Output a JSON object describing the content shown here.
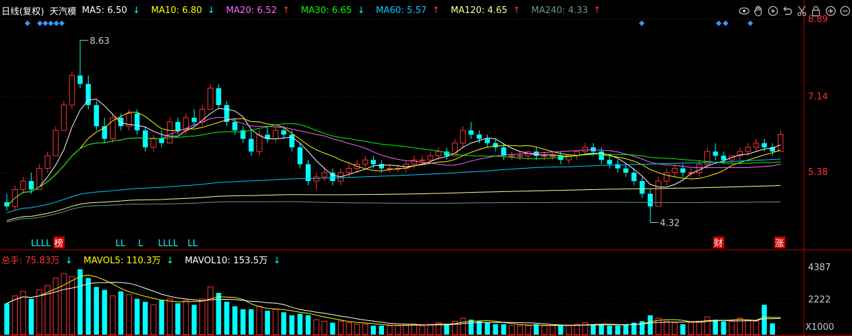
{
  "legend": {
    "period": "日线(复权)",
    "stock": "天汽模",
    "ma": [
      {
        "label": "MA5: 6.50",
        "arrow": "↓",
        "color": "#ffffff"
      },
      {
        "label": "MA10: 6.80",
        "arrow": "↓",
        "color": "#ffff00"
      },
      {
        "label": "MA20: 6.52",
        "arrow": "↑",
        "color": "#ff66ff"
      },
      {
        "label": "MA30: 6.65",
        "arrow": "↓",
        "color": "#00ff00"
      },
      {
        "label": "MA60: 5.57",
        "arrow": "↑",
        "color": "#00ccff"
      },
      {
        "label": "MA120: 4.65",
        "arrow": "↑",
        "color": "#ffff99"
      },
      {
        "label": "MA240: 4.33",
        "arrow": "↑",
        "color": "#669999"
      }
    ]
  },
  "vol_legend": {
    "total": "总手: 75.83万",
    "total_arrow": "↓",
    "mavol5": "MAVOL5: 110.3万",
    "mavol5_arrow": "↓",
    "mavol10": "MAVOL10: 153.5万",
    "mavol10_arrow": "↓"
  },
  "toolbar": [
    "eye-icon",
    "hand-icon",
    "play-icon",
    "undo-icon",
    "scissors-icon",
    "lock-icon",
    "zoom-in-icon",
    "zoom-out-icon"
  ],
  "price_axis": {
    "ticks": [
      "8.89",
      "7.14",
      "5.38"
    ],
    "color": "#ff3333"
  },
  "volume_axis": {
    "ticks": [
      "4387",
      "2222"
    ],
    "unit": "X1000"
  },
  "annotations": {
    "high": "8.63",
    "low": "4.32"
  },
  "event_markers": [
    {
      "text": "LLLL",
      "color": "#00ffff"
    },
    {
      "text": "榜",
      "color": "#ffffff",
      "bg": "#cc0000"
    },
    {
      "text": "LL",
      "color": "#00ffff"
    },
    {
      "text": "L",
      "color": "#00ffff"
    },
    {
      "text": "LLLL",
      "color": "#00ffff"
    },
    {
      "text": "LL",
      "color": "#00ffff"
    },
    {
      "text": "财",
      "color": "#ffffff",
      "bg": "#cc0000"
    },
    {
      "text": "涨",
      "color": "#ffffff",
      "bg": "#cc0000"
    }
  ],
  "colors": {
    "up": "#ff3333",
    "down": "#00ffff",
    "grid": "#cc0000",
    "bg": "#000000",
    "diamond": "#3399ff"
  },
  "chart_data": {
    "type": "candlestick",
    "price_range": [
      4.1,
      9.1
    ],
    "ohlc": [
      [
        4.8,
        5.0,
        4.6,
        4.7
      ],
      [
        4.7,
        5.2,
        4.6,
        5.1
      ],
      [
        5.1,
        5.4,
        5.0,
        5.3
      ],
      [
        5.3,
        5.5,
        5.0,
        5.1
      ],
      [
        5.1,
        5.7,
        5.1,
        5.6
      ],
      [
        5.6,
        6.0,
        5.5,
        5.9
      ],
      [
        5.9,
        6.6,
        5.9,
        6.5
      ],
      [
        6.5,
        7.2,
        6.5,
        7.1
      ],
      [
        7.1,
        7.9,
        7.0,
        7.8
      ],
      [
        7.8,
        8.63,
        7.5,
        7.6
      ],
      [
        7.6,
        7.8,
        7.0,
        7.1
      ],
      [
        7.1,
        7.2,
        6.5,
        6.6
      ],
      [
        6.6,
        6.8,
        6.2,
        6.3
      ],
      [
        6.3,
        6.9,
        6.2,
        6.8
      ],
      [
        6.8,
        6.9,
        6.5,
        6.6
      ],
      [
        6.6,
        7.0,
        6.5,
        6.9
      ],
      [
        6.9,
        7.0,
        6.4,
        6.5
      ],
      [
        6.5,
        6.6,
        6.0,
        6.1
      ],
      [
        6.1,
        6.4,
        6.0,
        6.3
      ],
      [
        6.3,
        6.5,
        6.1,
        6.2
      ],
      [
        6.2,
        6.8,
        6.2,
        6.7
      ],
      [
        6.7,
        6.8,
        6.4,
        6.5
      ],
      [
        6.5,
        6.9,
        6.4,
        6.8
      ],
      [
        6.8,
        7.0,
        6.6,
        6.7
      ],
      [
        6.7,
        7.1,
        6.6,
        7.0
      ],
      [
        7.0,
        7.6,
        7.0,
        7.5
      ],
      [
        7.5,
        7.6,
        7.0,
        7.1
      ],
      [
        7.1,
        7.2,
        6.6,
        6.7
      ],
      [
        6.7,
        6.8,
        6.4,
        6.5
      ],
      [
        6.5,
        6.6,
        6.2,
        6.3
      ],
      [
        6.3,
        6.5,
        5.9,
        6.0
      ],
      [
        6.0,
        6.5,
        5.9,
        6.4
      ],
      [
        6.4,
        6.6,
        6.2,
        6.3
      ],
      [
        6.3,
        6.6,
        6.2,
        6.5
      ],
      [
        6.5,
        6.6,
        6.3,
        6.4
      ],
      [
        6.4,
        6.5,
        6.0,
        6.1
      ],
      [
        6.1,
        6.2,
        5.6,
        5.7
      ],
      [
        5.7,
        5.8,
        5.2,
        5.3
      ],
      [
        5.3,
        5.5,
        5.1,
        5.4
      ],
      [
        5.4,
        5.6,
        5.3,
        5.5
      ],
      [
        5.5,
        5.6,
        5.2,
        5.3
      ],
      [
        5.3,
        5.6,
        5.2,
        5.5
      ],
      [
        5.5,
        5.7,
        5.4,
        5.6
      ],
      [
        5.6,
        5.8,
        5.5,
        5.7
      ],
      [
        5.7,
        5.9,
        5.6,
        5.8
      ],
      [
        5.8,
        5.9,
        5.6,
        5.7
      ],
      [
        5.7,
        5.8,
        5.5,
        5.6
      ],
      [
        5.6,
        5.7,
        5.5,
        5.6
      ],
      [
        5.6,
        5.7,
        5.5,
        5.6
      ],
      [
        5.6,
        5.8,
        5.5,
        5.7
      ],
      [
        5.7,
        5.9,
        5.6,
        5.8
      ],
      [
        5.8,
        5.9,
        5.7,
        5.8
      ],
      [
        5.8,
        6.0,
        5.7,
        5.9
      ],
      [
        5.9,
        6.1,
        5.8,
        6.0
      ],
      [
        6.0,
        6.1,
        5.8,
        5.9
      ],
      [
        5.9,
        6.3,
        5.9,
        6.2
      ],
      [
        6.2,
        6.6,
        6.1,
        6.5
      ],
      [
        6.5,
        6.7,
        6.3,
        6.4
      ],
      [
        6.4,
        6.5,
        6.2,
        6.3
      ],
      [
        6.3,
        6.4,
        6.1,
        6.2
      ],
      [
        6.2,
        6.3,
        6.0,
        6.1
      ],
      [
        6.1,
        6.2,
        5.8,
        5.9
      ],
      [
        5.9,
        6.0,
        5.8,
        5.9
      ],
      [
        5.9,
        6.0,
        5.8,
        5.9
      ],
      [
        5.9,
        6.0,
        5.8,
        6.0
      ],
      [
        6.0,
        6.1,
        5.8,
        5.9
      ],
      [
        5.9,
        6.0,
        5.8,
        5.9
      ],
      [
        5.9,
        6.0,
        5.8,
        5.9
      ],
      [
        5.9,
        6.0,
        5.7,
        5.8
      ],
      [
        5.8,
        5.9,
        5.7,
        5.9
      ],
      [
        5.9,
        6.0,
        5.8,
        6.0
      ],
      [
        6.0,
        6.2,
        5.9,
        6.1
      ],
      [
        6.1,
        6.2,
        5.9,
        6.0
      ],
      [
        6.0,
        6.1,
        5.7,
        5.8
      ],
      [
        5.8,
        5.9,
        5.6,
        5.7
      ],
      [
        5.7,
        5.8,
        5.5,
        5.6
      ],
      [
        5.6,
        5.7,
        5.4,
        5.5
      ],
      [
        5.5,
        5.6,
        5.2,
        5.3
      ],
      [
        5.3,
        5.4,
        4.9,
        5.0
      ],
      [
        5.0,
        5.1,
        4.32,
        4.7
      ],
      [
        4.7,
        5.4,
        4.7,
        5.3
      ],
      [
        5.3,
        5.6,
        5.2,
        5.5
      ],
      [
        5.5,
        5.7,
        5.4,
        5.6
      ],
      [
        5.6,
        5.7,
        5.4,
        5.5
      ],
      [
        5.5,
        5.6,
        5.4,
        5.5
      ],
      [
        5.5,
        5.8,
        5.4,
        5.7
      ],
      [
        5.7,
        6.1,
        5.6,
        6.0
      ],
      [
        6.0,
        6.2,
        5.8,
        5.9
      ],
      [
        5.9,
        6.0,
        5.7,
        5.8
      ],
      [
        5.8,
        5.9,
        5.7,
        5.9
      ],
      [
        5.9,
        6.1,
        5.8,
        6.0
      ],
      [
        6.0,
        6.2,
        5.9,
        6.1
      ],
      [
        6.1,
        6.3,
        6.0,
        6.2
      ],
      [
        6.2,
        6.3,
        6.0,
        6.1
      ],
      [
        6.1,
        6.2,
        5.9,
        6.0
      ],
      [
        6.0,
        6.5,
        6.0,
        6.4
      ]
    ],
    "volume": [
      2100,
      2600,
      2900,
      2400,
      3000,
      3300,
      3800,
      4100,
      3900,
      4387,
      3800,
      3200,
      3000,
      2600,
      2900,
      2700,
      2400,
      2200,
      2000,
      2300,
      2400,
      2100,
      2300,
      2000,
      2400,
      3200,
      2800,
      2200,
      1900,
      1700,
      1700,
      1900,
      1600,
      1700,
      1500,
      1300,
      1400,
      1300,
      1000,
      900,
      800,
      900,
      800,
      700,
      700,
      600,
      600,
      600,
      600,
      700,
      700,
      600,
      700,
      800,
      700,
      900,
      1100,
      1000,
      900,
      800,
      700,
      700,
      600,
      600,
      600,
      700,
      600,
      600,
      600,
      600,
      700,
      800,
      700,
      700,
      600,
      600,
      700,
      800,
      900,
      1300,
      1100,
      900,
      800,
      700,
      800,
      900,
      1200,
      1000,
      900,
      900,
      1100,
      1000,
      900,
      2000,
      758
    ],
    "volume_range": [
      0,
      4600
    ]
  }
}
